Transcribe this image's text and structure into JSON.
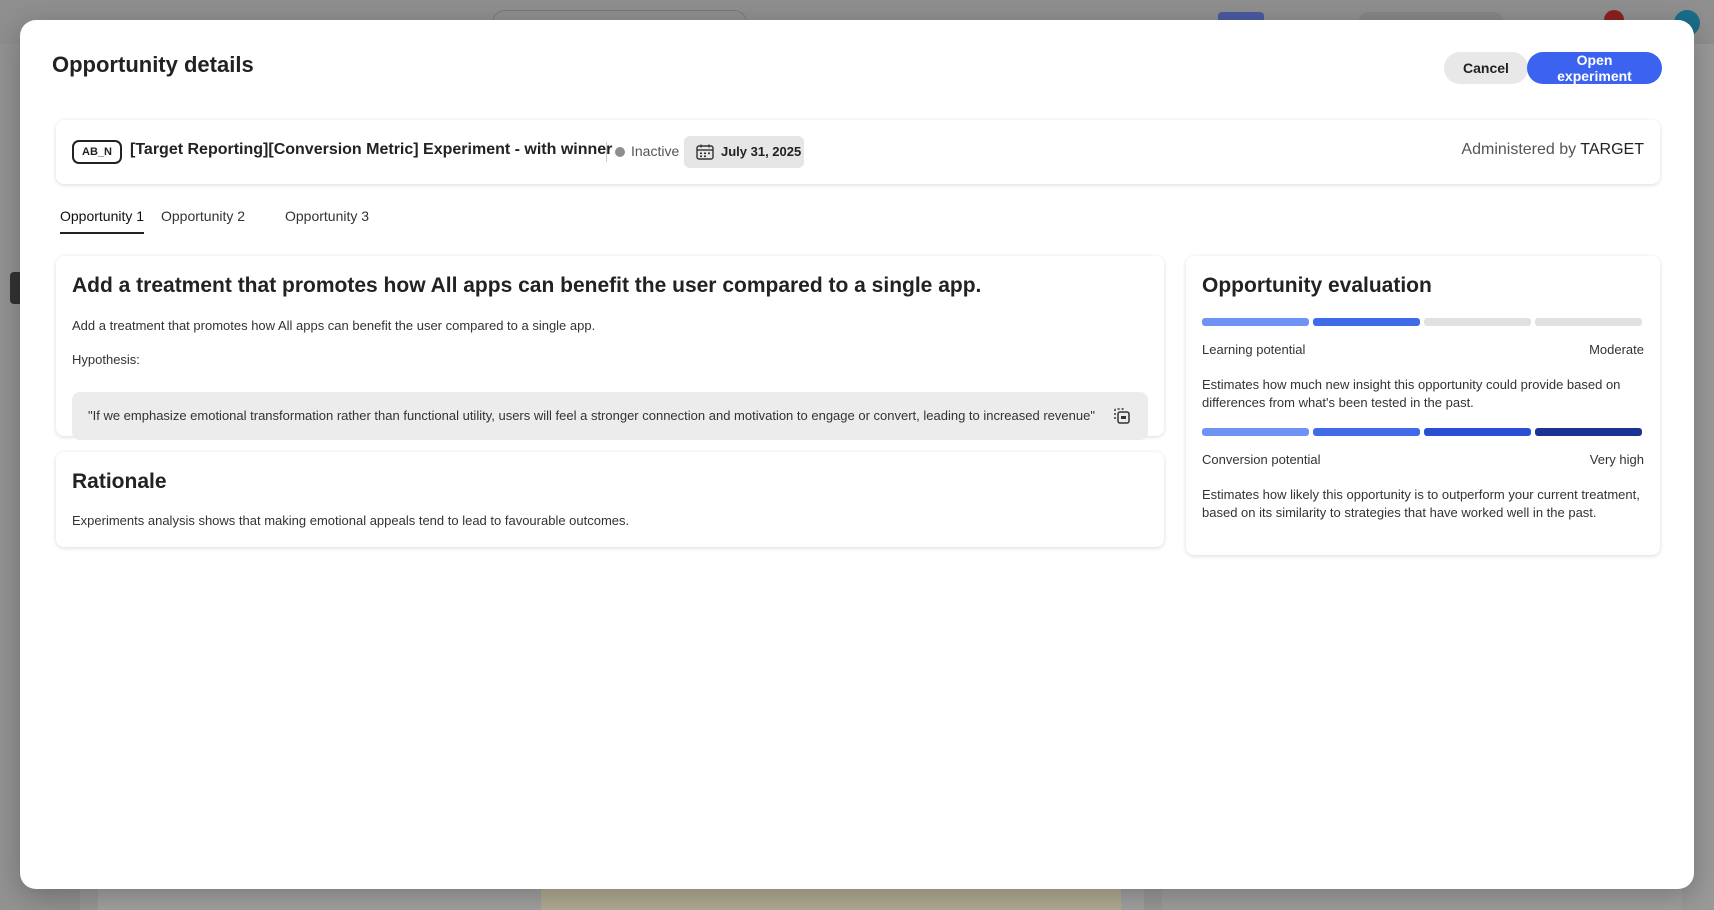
{
  "modal": {
    "title": "Opportunity details",
    "cancel_label": "Cancel",
    "open_label": "Open experiment"
  },
  "experiment": {
    "tag": "AB_N",
    "name": "[Target Reporting][Conversion Metric] Experiment - with winner",
    "status": "Inactive",
    "date": "July 31, 2025",
    "admin_prefix": "Administered by",
    "admin_name": "TARGET"
  },
  "tabs": [
    {
      "label": "Opportunity 1",
      "active": true
    },
    {
      "label": "Opportunity 2",
      "active": false
    },
    {
      "label": "Opportunity 3",
      "active": false
    }
  ],
  "opportunity": {
    "title": "Add a treatment that promotes how All apps can benefit the user compared to a single app.",
    "description": "Add a treatment that promotes how All apps can benefit the user compared to a single app.",
    "hypothesis_label": "Hypothesis:",
    "hypothesis": "\"If we emphasize emotional transformation rather than functional utility, users will feel a stronger connection and motivation to engage or convert, leading to increased revenue\""
  },
  "rationale": {
    "title": "Rationale",
    "text": "Experiments analysis shows that making emotional appeals tend to lead to favourable outcomes."
  },
  "evaluation": {
    "title": "Opportunity evaluation",
    "learning": {
      "label": "Learning potential",
      "value": "Moderate",
      "level": 2,
      "max": 4,
      "description": "Estimates how much new insight this opportunity could provide based on differences from what's been tested in the past."
    },
    "conversion": {
      "label": "Conversion potential",
      "value": "Very high",
      "level": 4,
      "max": 4,
      "description": "Estimates how likely this opportunity is to outperform your current treatment, based on its similarity to strategies that have worked well in the past."
    }
  },
  "colors": {
    "primary": "#3b63f0",
    "segment_1": "#6f93f5",
    "segment_2": "#3f6ae8",
    "segment_3": "#2b4fd4",
    "segment_4": "#1c3394",
    "segment_empty": "#e1e1e1",
    "status_inactive": "#8e8e8e"
  }
}
